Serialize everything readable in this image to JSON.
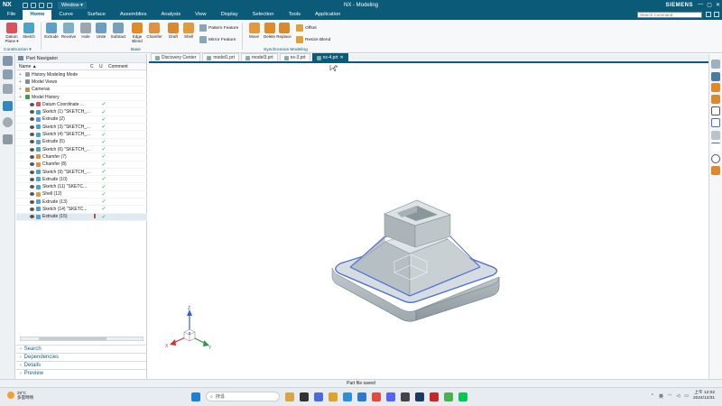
{
  "title_bar": {
    "logo": "NX",
    "window_menu": "Window ▾",
    "app_title": "NX - Modeling",
    "brand": "SIEMENS",
    "controls": [
      "—",
      "▢",
      "✕"
    ]
  },
  "menu": {
    "items": [
      "File",
      "Home",
      "Curve",
      "Surface",
      "Assemblies",
      "Analysis",
      "View",
      "Display",
      "Selection",
      "Tools",
      "Application"
    ],
    "active": "Home",
    "search_placeholder": "Search Command"
  },
  "ribbon": {
    "construction_buttons": [
      {
        "label": "Datum Plane ▾",
        "icon": "datum-plane-icon",
        "color": "#d9535f"
      },
      {
        "label": "Sketch",
        "icon": "sketch-icon",
        "color": "#4ba3c7"
      }
    ],
    "construction_label": "Construction ▾",
    "base_buttons": [
      {
        "label": "Extrude",
        "icon": "extrude-icon",
        "color": "#5aa0c8"
      },
      {
        "label": "Revolve",
        "icon": "revolve-icon",
        "color": "#7fb0c8"
      },
      {
        "label": "Hole",
        "icon": "hole-icon",
        "color": "#9aa7b0"
      },
      {
        "label": "Unite",
        "icon": "unite-icon",
        "color": "#6b9ec0"
      },
      {
        "label": "Subtract",
        "icon": "subtract-icon",
        "color": "#7a9fb8"
      },
      {
        "label": "Edge Blend",
        "icon": "edge-blend-icon",
        "color": "#e08a2a"
      },
      {
        "label": "Chamfer",
        "icon": "chamfer-icon",
        "color": "#e09040"
      },
      {
        "label": "Draft",
        "icon": "draft-icon",
        "color": "#d9892f"
      },
      {
        "label": "Shell",
        "icon": "shell-icon",
        "color": "#e39a3e"
      }
    ],
    "base_small": [
      {
        "label": "Pattern Feature",
        "icon": "pattern-feature-icon"
      },
      {
        "label": "Mirror Feature",
        "icon": "mirror-feature-icon"
      }
    ],
    "base_label": "Base",
    "sync_buttons": [
      {
        "label": "Move",
        "icon": "move-face-icon",
        "color": "#e39a3e"
      },
      {
        "label": "Delete",
        "icon": "delete-face-icon",
        "color": "#e08a2a"
      },
      {
        "label": "Replace",
        "icon": "replace-face-icon",
        "color": "#d9892f"
      }
    ],
    "sync_small": [
      {
        "label": "Offset",
        "icon": "offset-face-icon"
      },
      {
        "label": "Resize Blend",
        "icon": "resize-blend-icon"
      }
    ],
    "sync_label": "Synchronous Modeling"
  },
  "navigator": {
    "title": "Part Navigator",
    "columns": {
      "name": "Name",
      "c": "C",
      "u": "U",
      "comment": "Comment"
    },
    "rows": [
      {
        "label": "History Modeling Mode",
        "icon": "history-mode-icon",
        "color": "#999",
        "indent": 0,
        "check": "",
        "flag": false
      },
      {
        "label": "Model Views",
        "icon": "model-views-icon",
        "color": "#7a8fa0",
        "indent": 0,
        "check": "",
        "flag": false
      },
      {
        "label": "Cameras",
        "icon": "cameras-icon",
        "color": "#c78d3b",
        "indent": 0,
        "check": "",
        "flag": false
      },
      {
        "label": "Model History",
        "icon": "model-history-icon",
        "color": "#3aa04a",
        "indent": 0,
        "check": "",
        "flag": false
      },
      {
        "label": "Datum Coordinate ...",
        "icon": "datum-csys-icon",
        "color": "#d9535f",
        "indent": 1,
        "check": "✓",
        "flag": false
      },
      {
        "label": "Sketch (1) \"SKETCH_...",
        "icon": "sketch-icon",
        "color": "#4ba3c7",
        "indent": 1,
        "check": "✓",
        "flag": false
      },
      {
        "label": "Extrude (2)",
        "icon": "extrude-icon",
        "color": "#5aa0c8",
        "indent": 1,
        "check": "✓",
        "flag": false
      },
      {
        "label": "Sketch (3) \"SKETCH_...",
        "icon": "sketch-icon",
        "color": "#4ba3c7",
        "indent": 1,
        "check": "✓",
        "flag": false
      },
      {
        "label": "Sketch (4) \"SKETCH_...",
        "icon": "sketch-icon",
        "color": "#4ba3c7",
        "indent": 1,
        "check": "✓",
        "flag": false
      },
      {
        "label": "Extrude (5)",
        "icon": "extrude-icon",
        "color": "#5aa0c8",
        "indent": 1,
        "check": "✓",
        "flag": false
      },
      {
        "label": "Sketch (6) \"SKETCH_...",
        "icon": "sketch-icon",
        "color": "#4ba3c7",
        "indent": 1,
        "check": "✓",
        "flag": false
      },
      {
        "label": "Chamfer (7)",
        "icon": "chamfer-icon",
        "color": "#e09040",
        "indent": 1,
        "check": "✓",
        "flag": false
      },
      {
        "label": "Chamfer (8)",
        "icon": "chamfer-icon",
        "color": "#e09040",
        "indent": 1,
        "check": "✓",
        "flag": false
      },
      {
        "label": "Sketch (9) \"SKETCH_...",
        "icon": "sketch-icon",
        "color": "#4ba3c7",
        "indent": 1,
        "check": "✓",
        "flag": false
      },
      {
        "label": "Extrude (10)",
        "icon": "extrude-icon",
        "color": "#5aa0c8",
        "indent": 1,
        "check": "✓",
        "flag": false
      },
      {
        "label": "Sketch (11) \"SKETC...",
        "icon": "sketch-icon",
        "color": "#4ba3c7",
        "indent": 1,
        "check": "✓",
        "flag": false
      },
      {
        "label": "Shell (12)",
        "icon": "shell-icon",
        "color": "#e39a3e",
        "indent": 1,
        "check": "✓",
        "flag": false
      },
      {
        "label": "Extrude (13)",
        "icon": "extrude-icon",
        "color": "#5aa0c8",
        "indent": 1,
        "check": "✓",
        "flag": false
      },
      {
        "label": "Sketch (14) \"SKETC...",
        "icon": "sketch-icon",
        "color": "#4ba3c7",
        "indent": 1,
        "check": "✓",
        "flag": false
      },
      {
        "label": "Extrude (15)",
        "icon": "extrude-icon",
        "color": "#5aa0c8",
        "indent": 1,
        "check": "✓",
        "flag": true
      }
    ],
    "panels": [
      "Search",
      "Dependencies",
      "Details",
      "Preview"
    ]
  },
  "doc_tabs": [
    {
      "label": "Discovery Center",
      "active": false
    },
    {
      "label": "model1.prt",
      "active": false
    },
    {
      "label": "model3.prt",
      "active": false
    },
    {
      "label": "nx-3.prt",
      "active": false
    },
    {
      "label": "nx-4.prt",
      "active": true
    }
  ],
  "triad": {
    "x": "X",
    "y": "Y",
    "z": "Z"
  },
  "status": "Part file saved",
  "taskbar": {
    "weather_temp": "29°C",
    "weather_desc": "多雲時晴",
    "search_placeholder": "搜尋",
    "lang": "英",
    "time": "上午 12:02",
    "date": "2024/12/31"
  },
  "colors": {
    "accent": "#0a5a78",
    "model_face": "#d6dde0",
    "model_edge": "#4a6bd8"
  }
}
